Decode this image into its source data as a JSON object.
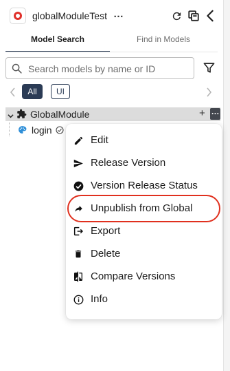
{
  "header": {
    "title": "globalModuleTest",
    "more": "…"
  },
  "tabs": [
    {
      "label": "Model Search",
      "active": true
    },
    {
      "label": "Find in Models",
      "active": false
    }
  ],
  "search": {
    "placeholder": "Search models by name or ID",
    "value": ""
  },
  "chips": [
    "All",
    "UI"
  ],
  "tree": {
    "root_label": "GlobalModule",
    "add_label": "+",
    "more_label": "…",
    "child_label": "login"
  },
  "menu": {
    "items": [
      {
        "label": "Edit",
        "icon": "pencil-icon"
      },
      {
        "label": "Release Version",
        "icon": "send-icon"
      },
      {
        "label": "Version Release Status",
        "icon": "check-circle-icon"
      },
      {
        "label": "Unpublish from Global",
        "icon": "share-arrow-icon",
        "highlighted": true
      },
      {
        "label": "Export",
        "icon": "export-icon"
      },
      {
        "label": "Delete",
        "icon": "trash-icon"
      },
      {
        "label": "Compare Versions",
        "icon": "compare-icon"
      },
      {
        "label": "Info",
        "icon": "info-icon"
      }
    ]
  },
  "colors": {
    "accent": "#2b3b55",
    "highlight_ring": "#e0301e",
    "brand": "#e0312b"
  }
}
